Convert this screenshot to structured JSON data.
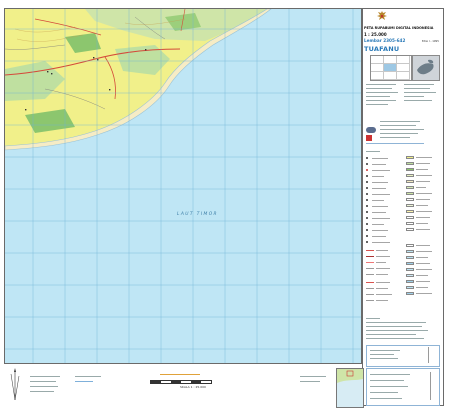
{
  "map": {
    "sea_label": "LAUT TIMOR",
    "colors": {
      "sea": "#bfe6f5",
      "land_cultivated": "#f1f08a",
      "land_forest": "#bfe0a0",
      "land_green": "#8cc66e",
      "shore_sand": "#f6ecc5",
      "road": "#d44a3a",
      "grid": "#6fb2d6",
      "frame": "#6a6a6a"
    }
  },
  "legend": {
    "title_series": "PETA RUPABUMI DIGITAL INDONESIA",
    "scale": "1 : 25.000",
    "sheet_number": "Lembar 2305-642",
    "sheet_name": "TUAFANU",
    "edition": "Edisi I - 1995",
    "index_icon": "indonesia-index-map",
    "emblem_icon": "garuda-emblem-icon"
  },
  "bottom": {
    "scale_label": "SKALA 1 : 25.000"
  }
}
